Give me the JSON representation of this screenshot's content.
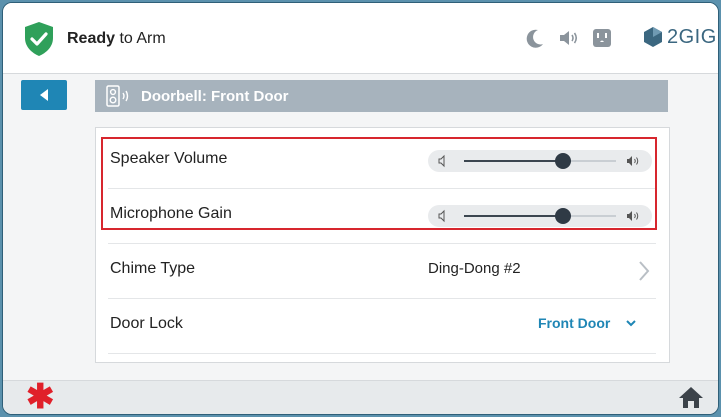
{
  "header": {
    "status_bold": "Ready",
    "status_rest": " to Arm",
    "brand": "2GIG",
    "icons": [
      "shield-check-icon",
      "moon-icon",
      "speaker-icon",
      "outlet-icon",
      "2gig-logo-icon"
    ]
  },
  "page": {
    "title": "Doorbell: Front Door"
  },
  "settings": {
    "speaker_volume_label": "Speaker Volume",
    "speaker_volume_level": 0.65,
    "microphone_gain_label": "Microphone Gain",
    "microphone_gain_level": 0.65,
    "chime_type_label": "Chime Type",
    "chime_type_value": "Ding-Dong #2",
    "door_lock_label": "Door Lock",
    "door_lock_value": "Front Door"
  },
  "footer": {
    "icons": [
      "asterisk-icon",
      "home-icon"
    ]
  },
  "colors": {
    "accent": "#1f86b5",
    "shield": "#2fa05a",
    "highlight": "#d7262e",
    "titlebar": "#a7b3bd"
  }
}
